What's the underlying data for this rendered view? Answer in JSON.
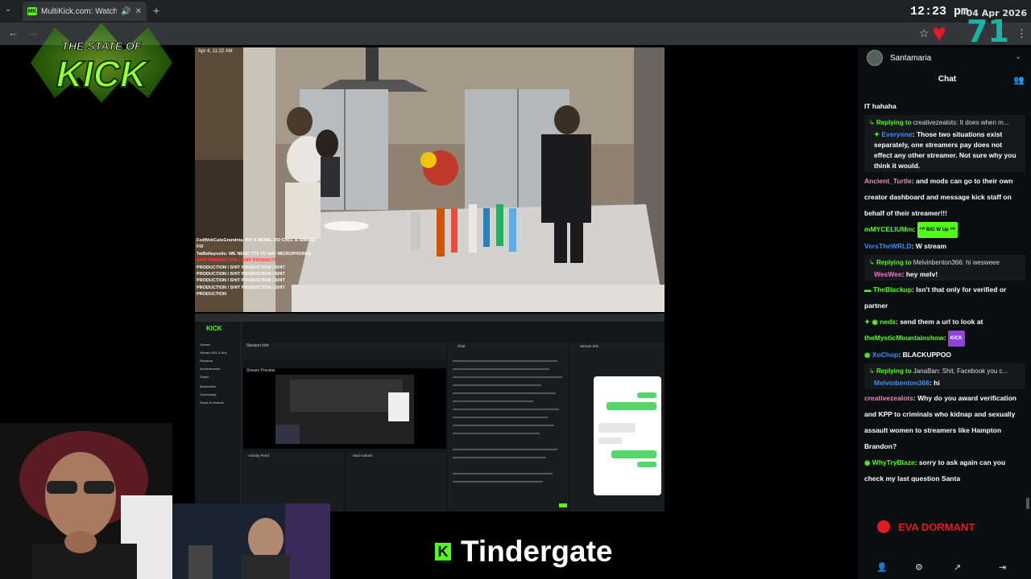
{
  "browser": {
    "tab_title": "MultiKick.com: Watch Multi",
    "favicon_label": "MK",
    "clock": "12:23 pm",
    "date": "04 Apr 2026",
    "counter": "71"
  },
  "logo": {
    "line1": "THE STATE OF",
    "line2": "KICK"
  },
  "video": {
    "timestamp": "Apr 4, 11:22 AM",
    "overlay_lines": [
      "FedWebCatsGrandma, INT & MORE, DO CALL & SIMPLE",
      "FIX",
      "TatBellayoelis: WE NEED TTS TO SAY MICROPHONES",
      "SHIT PRODUCTION / SHIT PRODUCTION",
      "PRODUCTION / SHIT PRODUCTION / SHIT",
      "PRODUCTION / SHIT PRODUCTION / SHIT",
      "PRODUCTION / SHIT PRODUCTION / SHIT",
      "PRODUCTION / SHIT PRODUCTION / SHIT",
      "PRODUCTION"
    ]
  },
  "dashboard": {
    "brand": "KICK",
    "session_info": "Session Info",
    "stream_preview": "Stream Preview",
    "activity_feed": "Activity Feed",
    "mod_actions": "Mod Actions",
    "chat": "Chat",
    "stream_info": "Stream Info",
    "side_items": [
      "Stream",
      "Stream URL & Key",
      "Rewards",
      "Achievements",
      "Studio",
      "Moderation",
      "Community",
      "Drops & rewards"
    ]
  },
  "caption": {
    "k": "K",
    "text": "Tindergate"
  },
  "chat": {
    "username": "Santamaria",
    "title": "Chat",
    "messages": [
      {
        "type": "plain",
        "user": "",
        "text": "IT hahaha"
      },
      {
        "type": "reply",
        "reply_to": "Replying to",
        "reply_user": "creativezealots:",
        "reply_text": "It does when m...",
        "badge": "✦",
        "user": "Everyone",
        "user_color": "#3f8cff",
        "text": "Those two situations exist separately, one streamers pay does not effect any other streamer. Not sure why you think it would."
      },
      {
        "type": "plain",
        "user": "Ancient_Turtle",
        "user_color": "#e88fb0",
        "text": "and mods can go to their own creator dashboard and message kick staff on behalf of their streamer!!!"
      },
      {
        "type": "emote",
        "user": "mMYCELIUMm",
        "user_color": "#53fc18",
        "text": "ᴬᵂ BIG W Up ᴬᵂ"
      },
      {
        "type": "plain",
        "user": "VersTheWRLD",
        "user_color": "#3f8cff",
        "text": "W stream"
      },
      {
        "type": "reply",
        "reply_to": "Replying to",
        "reply_user": "Melvinbenton366:",
        "reply_text": "hi wesweee",
        "badge": "",
        "user": "WesWee",
        "user_color": "#ff6bcb",
        "text": "hey melv!"
      },
      {
        "type": "plain_badge",
        "badge": "▬",
        "user": "TheBlackup",
        "user_color": "#53fc18",
        "text": "Isn't that only for verified or partner"
      },
      {
        "type": "plain_badge",
        "badge": "✦ ◉",
        "user": "nedx",
        "user_color": "#53fc18",
        "text": "send them a url to look at"
      },
      {
        "type": "emote_p",
        "user": "theMysticMountainshow",
        "user_color": "#53fc18",
        "text": "KICK"
      },
      {
        "type": "plain_badge",
        "badge": "◉",
        "user": "XoChop",
        "user_color": "#3f8cff",
        "text": "BLACKUPPOO"
      },
      {
        "type": "reply",
        "reply_to": "Replying to",
        "reply_user": "JanaBan:",
        "reply_text": "Shit, Facebook you c...",
        "badge": "",
        "user": "Melvinbenton366",
        "user_color": "#3f8cff",
        "text": "hi"
      },
      {
        "type": "plain",
        "user": "creativezealots",
        "user_color": "#e88fb0",
        "text": "Why do you award verification and KPP to criminals who kidnap and sexually assault women to streamers like Hampton Brandon?"
      },
      {
        "type": "plain_badge",
        "badge": "◉",
        "user": "WhyTryBlaze",
        "user_color": "#53fc18",
        "text": "sorry to ask again can you check my last question Santa"
      }
    ],
    "eva": "EVA DORMANT"
  }
}
